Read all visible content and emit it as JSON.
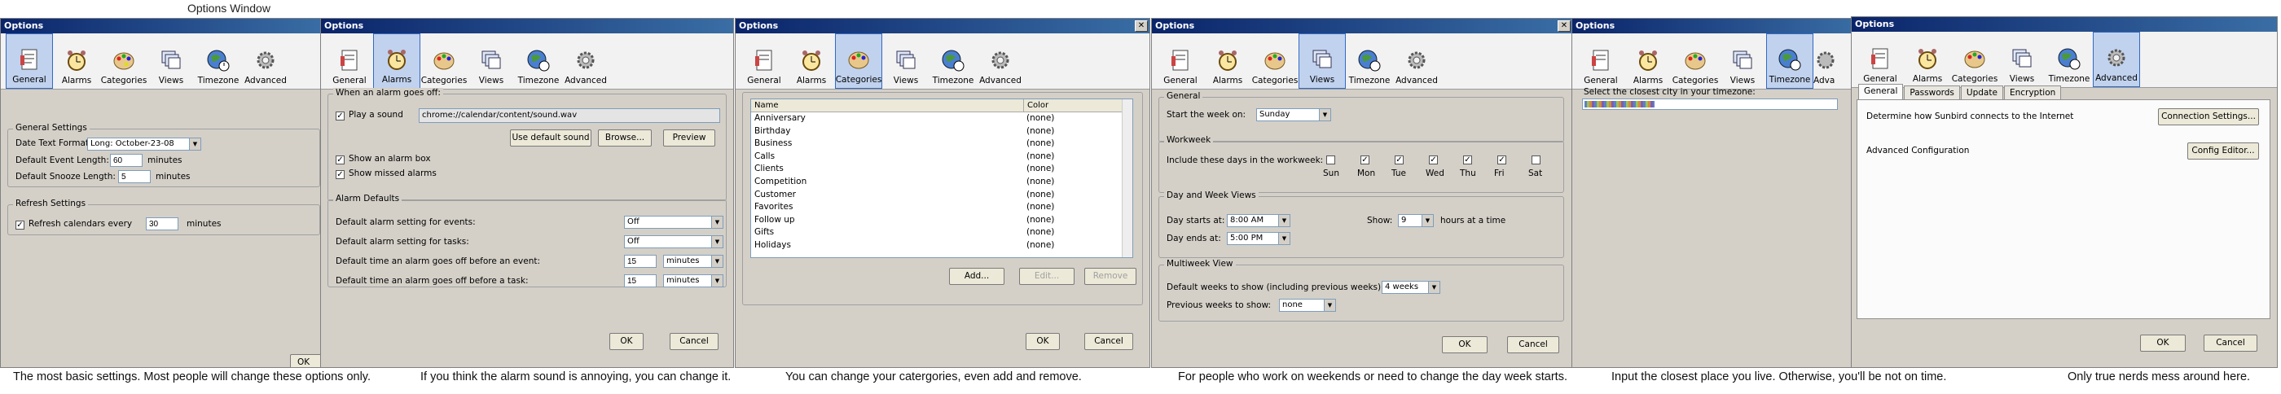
{
  "page_title": "Options Window",
  "toolbar_items": [
    "General",
    "Alarms",
    "Categories",
    "Views",
    "Timezone",
    "Advanced"
  ],
  "windows": [
    {
      "title": "Options",
      "selected": "General",
      "general_settings": {
        "group_title": "General Settings",
        "date_text_format_label": "Date Text Format:",
        "date_text_format_value": "Long: October-23-08",
        "default_event_length_label": "Default Event Length:",
        "default_event_length_value": "60",
        "default_snooze_length_label": "Default Snooze Length:",
        "default_snooze_length_value": "5",
        "minutes": "minutes"
      },
      "refresh": {
        "group_title": "Refresh Settings",
        "label": "Refresh calendars every",
        "value": "30",
        "unit": "minutes"
      },
      "ok": "OK"
    },
    {
      "title": "Options",
      "selected": "Alarms",
      "when_alarm": {
        "group_title": "When an alarm goes off:",
        "play_sound": "Play a sound",
        "sound_path": "chrome://calendar/content/sound.wav",
        "use_default": "Use default sound",
        "browse": "Browse...",
        "preview": "Preview",
        "show_box": "Show an alarm box",
        "show_missed": "Show missed alarms"
      },
      "alarm_defaults": {
        "group_title": "Alarm Defaults",
        "rows": [
          {
            "label": "Default alarm setting for events:",
            "value": "Off"
          },
          {
            "label": "Default alarm setting for tasks:",
            "value": "Off"
          },
          {
            "label": "Default time an alarm goes off before an event:",
            "value": "15",
            "unit": "minutes"
          },
          {
            "label": "Default time an alarm goes off before a task:",
            "value": "15",
            "unit": "minutes"
          }
        ]
      },
      "ok": "OK",
      "cancel": "Cancel"
    },
    {
      "title": "Options",
      "selected": "Categories",
      "columns": [
        "Name",
        "Color"
      ],
      "categories": [
        {
          "name": "Anniversary",
          "color": "(none)"
        },
        {
          "name": "Birthday",
          "color": "(none)"
        },
        {
          "name": "Business",
          "color": "(none)"
        },
        {
          "name": "Calls",
          "color": "(none)"
        },
        {
          "name": "Clients",
          "color": "(none)"
        },
        {
          "name": "Competition",
          "color": "(none)"
        },
        {
          "name": "Customer",
          "color": "(none)"
        },
        {
          "name": "Favorites",
          "color": "(none)"
        },
        {
          "name": "Follow up",
          "color": "(none)"
        },
        {
          "name": "Gifts",
          "color": "(none)"
        },
        {
          "name": "Holidays",
          "color": "(none)"
        }
      ],
      "add": "Add...",
      "edit": "Edit...",
      "remove": "Remove",
      "ok": "OK",
      "cancel": "Cancel"
    },
    {
      "title": "Options",
      "selected": "Views",
      "general": {
        "group_title": "General",
        "start_week_label": "Start the week on:",
        "start_week_value": "Sunday"
      },
      "workweek": {
        "group_title": "Workweek",
        "label": "Include these days in the workweek:",
        "days": [
          {
            "name": "Sun",
            "checked": false
          },
          {
            "name": "Mon",
            "checked": true
          },
          {
            "name": "Tue",
            "checked": true
          },
          {
            "name": "Wed",
            "checked": true
          },
          {
            "name": "Thu",
            "checked": true
          },
          {
            "name": "Fri",
            "checked": true
          },
          {
            "name": "Sat",
            "checked": false
          }
        ]
      },
      "day_week": {
        "group_title": "Day and Week Views",
        "day_starts_label": "Day starts at:",
        "day_starts_value": "8:00 AM",
        "day_ends_label": "Day ends at:",
        "day_ends_value": "5:00 PM",
        "show_label": "Show:",
        "show_value": "9",
        "hours_label": "hours at a time"
      },
      "multiweek": {
        "group_title": "Multiweek View",
        "default_weeks_label": "Default weeks to show (including previous weeks):",
        "default_weeks_value": "4 weeks",
        "previous_weeks_label": "Previous weeks to show:",
        "previous_weeks_value": "none"
      },
      "ok": "OK",
      "cancel": "Cancel"
    },
    {
      "title": "Options",
      "selected": "Timezone",
      "label": "Select the closest city in your timezone:",
      "partial_item": "Adva"
    },
    {
      "title": "Options",
      "selected": "Advanced",
      "tabs": [
        "General",
        "Passwords",
        "Update",
        "Encryption"
      ],
      "selected_tab": "General",
      "internet_label": "Determine how Sunbird connects to the Internet",
      "connection_settings": "Connection Settings...",
      "advanced_config_label": "Advanced Configuration",
      "config_editor": "Config Editor...",
      "ok": "OK",
      "cancel": "Cancel"
    }
  ],
  "captions": [
    "The most basic settings. Most people will change these options only.",
    "If you think the alarm sound is annoying, you can change it.",
    "You can change your catergories, even add and remove.",
    "For people who work on weekends or need to change the day week starts.",
    "Input the closest place you live. Otherwise, you'll be not on time.",
    "Only true nerds mess around here."
  ]
}
